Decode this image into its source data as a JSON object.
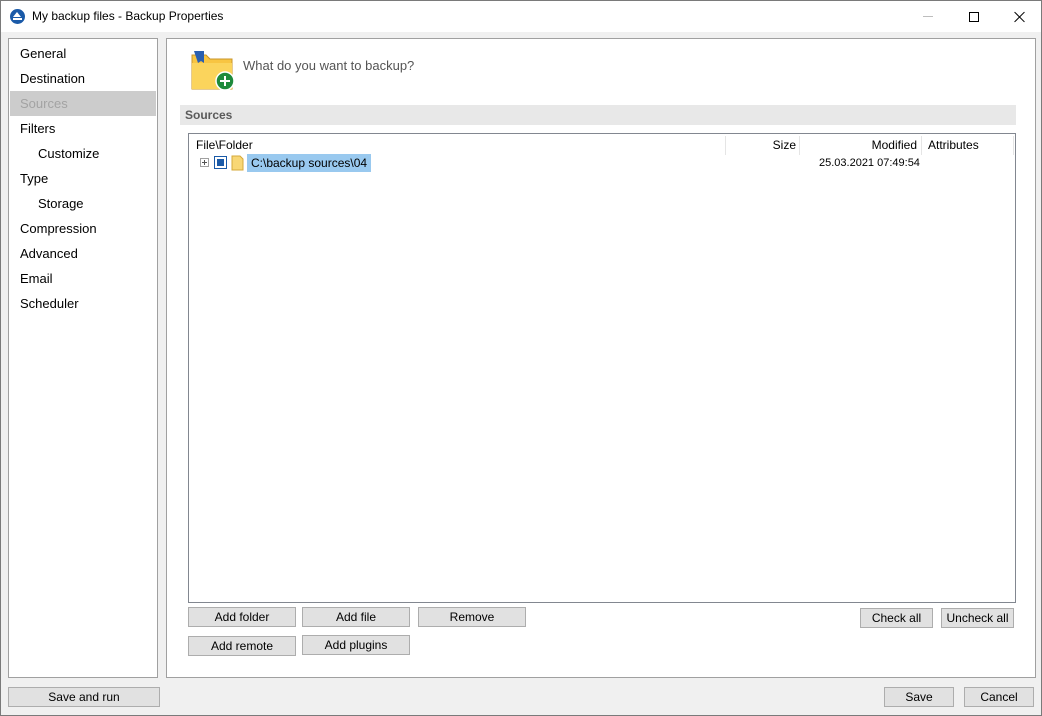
{
  "window": {
    "title": "My backup files - Backup Properties"
  },
  "sidebar": {
    "items": [
      {
        "label": "General",
        "indent": 0,
        "active": false
      },
      {
        "label": "Destination",
        "indent": 0,
        "active": false
      },
      {
        "label": "Sources",
        "indent": 0,
        "active": true
      },
      {
        "label": "Filters",
        "indent": 0,
        "active": false
      },
      {
        "label": "Customize",
        "indent": 1,
        "active": false
      },
      {
        "label": "Type",
        "indent": 0,
        "active": false
      },
      {
        "label": "Storage",
        "indent": 1,
        "active": false
      },
      {
        "label": "Compression",
        "indent": 0,
        "active": false
      },
      {
        "label": "Advanced",
        "indent": 0,
        "active": false
      },
      {
        "label": "Email",
        "indent": 0,
        "active": false
      },
      {
        "label": "Scheduler",
        "indent": 0,
        "active": false
      }
    ]
  },
  "main": {
    "question": "What do you want to backup?",
    "section_title": "Sources",
    "columns": {
      "file_folder": "File\\Folder",
      "size": "Size",
      "modified": "Modified",
      "attributes": "Attributes"
    },
    "rows": [
      {
        "path": "C:\\backup sources\\04",
        "size": "",
        "modified": "25.03.2021 07:49:54",
        "attributes": "",
        "checked": true
      }
    ],
    "buttons": {
      "add_folder": "Add folder",
      "add_file": "Add file",
      "remove": "Remove",
      "add_remote": "Add remote",
      "add_plugins": "Add plugins",
      "check_all": "Check all",
      "uncheck_all": "Uncheck all"
    }
  },
  "footer": {
    "save_and_run": "Save and run",
    "save": "Save",
    "cancel": "Cancel"
  },
  "colors": {
    "selection": "#99c9ef",
    "accent": "#1a5aa8",
    "active_nav_bg": "#cccccc",
    "folder": "#f8c542",
    "add_badge": "#1e8a3c"
  },
  "icons": {
    "app": "backup-app-icon",
    "header": "folder-add-icon",
    "row_folder": "folder-icon",
    "expander": "expand-plus-icon"
  }
}
